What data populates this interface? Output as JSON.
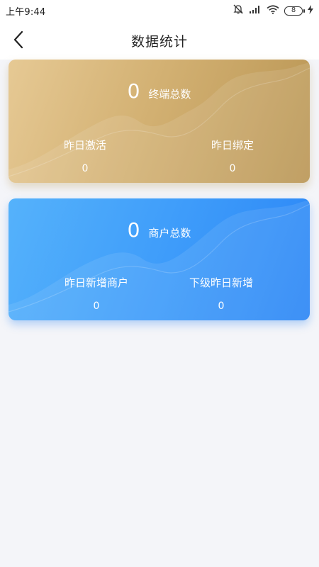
{
  "status_bar": {
    "time": "上午9:44",
    "battery": "8",
    "icons": [
      "mute-icon",
      "signal-icon",
      "wifi-icon",
      "battery-icon",
      "charging-icon"
    ]
  },
  "nav": {
    "title": "数据统计",
    "back_icon": "chevron-left-icon"
  },
  "terminal_card": {
    "total_value": "0",
    "total_label": "终端总数",
    "stats": [
      {
        "label": "昨日激活",
        "value": "0"
      },
      {
        "label": "昨日绑定",
        "value": "0"
      }
    ],
    "colors": {
      "start": "#e6c994",
      "end": "#b99553"
    }
  },
  "merchant_card": {
    "total_value": "0",
    "total_label": "商户总数",
    "stats": [
      {
        "label": "昨日新增商户",
        "value": "0"
      },
      {
        "label": "下级昨日新增",
        "value": "0"
      }
    ],
    "colors": {
      "start": "#55b2fb",
      "end": "#2b86f6"
    }
  }
}
